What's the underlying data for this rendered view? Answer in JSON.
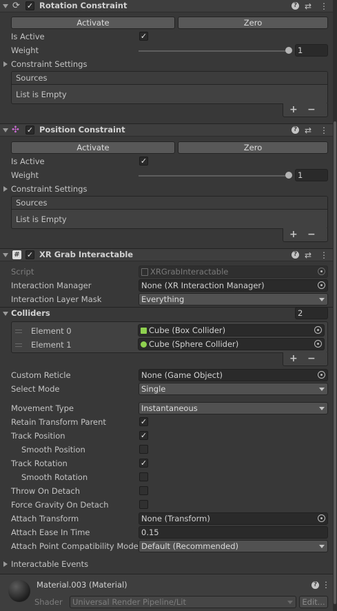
{
  "rotation_constraint": {
    "title": "Rotation Constraint",
    "enabled": true,
    "activate_label": "Activate",
    "zero_label": "Zero",
    "is_active_label": "Is Active",
    "is_active": true,
    "weight_label": "Weight",
    "weight_value": "1",
    "weight_fraction": 1.0,
    "constraint_settings_label": "Constraint Settings",
    "sources_label": "Sources",
    "list_empty": "List is Empty",
    "add_label": "+",
    "remove_label": "−"
  },
  "position_constraint": {
    "title": "Position Constraint",
    "enabled": true,
    "activate_label": "Activate",
    "zero_label": "Zero",
    "is_active_label": "Is Active",
    "is_active": true,
    "weight_label": "Weight",
    "weight_value": "1",
    "weight_fraction": 1.0,
    "constraint_settings_label": "Constraint Settings",
    "sources_label": "Sources",
    "list_empty": "List is Empty",
    "add_label": "+",
    "remove_label": "−"
  },
  "xr_grab": {
    "title": "XR Grab Interactable",
    "enabled": true,
    "script_label": "Script",
    "script_value": "XRGrabInteractable",
    "interaction_manager_label": "Interaction Manager",
    "interaction_manager_value": "None (XR Interaction Manager)",
    "interaction_layer_mask_label": "Interaction Layer Mask",
    "interaction_layer_mask_value": "Everything",
    "colliders_label": "Colliders",
    "colliders_count": "2",
    "colliders": [
      {
        "label": "Element 0",
        "value": "Cube (Box Collider)",
        "icon_color": "#8fd14f"
      },
      {
        "label": "Element 1",
        "value": "Cube (Sphere Collider)",
        "icon_color": "#8fd14f"
      }
    ],
    "add_label": "+",
    "remove_label": "−",
    "custom_reticle_label": "Custom Reticle",
    "custom_reticle_value": "None (Game Object)",
    "select_mode_label": "Select Mode",
    "select_mode_value": "Single",
    "movement_type_label": "Movement Type",
    "movement_type_value": "Instantaneous",
    "retain_transform_parent_label": "Retain Transform Parent",
    "retain_transform_parent": true,
    "track_position_label": "Track Position",
    "track_position": true,
    "smooth_position_label": "Smooth Position",
    "smooth_position": false,
    "track_rotation_label": "Track Rotation",
    "track_rotation": true,
    "smooth_rotation_label": "Smooth Rotation",
    "smooth_rotation": false,
    "throw_on_detach_label": "Throw On Detach",
    "throw_on_detach": false,
    "force_gravity_label": "Force Gravity On Detach",
    "force_gravity": false,
    "attach_transform_label": "Attach Transform",
    "attach_transform_value": "None (Transform)",
    "attach_ease_label": "Attach Ease In Time",
    "attach_ease_value": "0.15",
    "attach_compat_label": "Attach Point Compatibility Mode",
    "attach_compat_value": "Default (Recommended)",
    "interactable_events_label": "Interactable Events"
  },
  "material": {
    "title": "Material.003 (Material)",
    "shader_label": "Shader",
    "shader_value": "Universal Render Pipeline/Lit",
    "edit_label": "Edit..."
  },
  "icons": {
    "checkmark": "✓",
    "help": "?",
    "settings": "⇄",
    "more": "⋮"
  },
  "colors": {
    "background": "#383838",
    "header": "#3e3e3e",
    "field": "#2a2a2a",
    "button": "#585858"
  }
}
